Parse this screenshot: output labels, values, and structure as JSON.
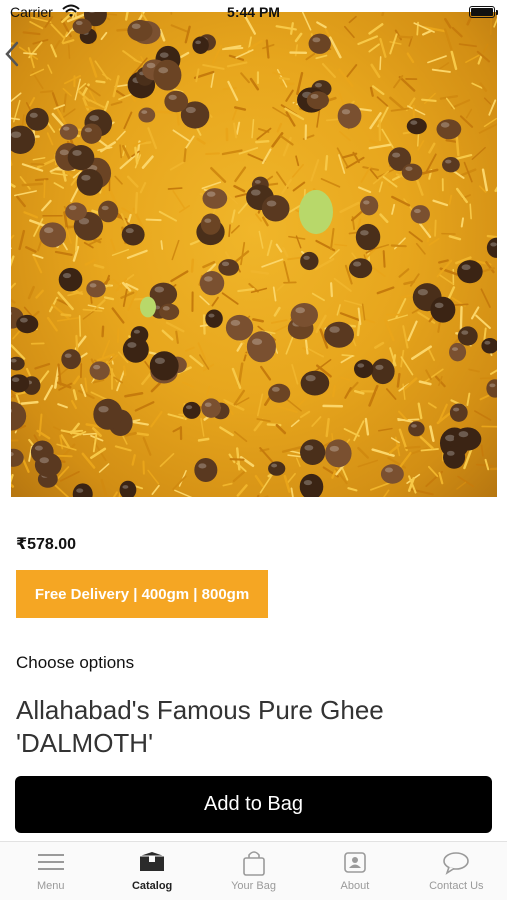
{
  "status_bar": {
    "carrier": "Carrier",
    "time": "5:44 PM"
  },
  "product": {
    "image_description_icon": "food-image",
    "price": "₹578.00",
    "badge": "Free Delivery | 400gm | 800gm",
    "choose_options": "Choose options",
    "title": "Allahabad's Famous Pure Ghee 'DALMOTH'",
    "add_to_bag": "Add to Bag"
  },
  "colors": {
    "badge": "#f5a623",
    "button": "#000000",
    "active_tab": "#222222",
    "inactive_tab": "#9a9a9a"
  },
  "tabs": [
    {
      "label": "Menu",
      "icon": "menu-icon",
      "active": false
    },
    {
      "label": "Catalog",
      "icon": "catalog-icon",
      "active": true
    },
    {
      "label": "Your Bag",
      "icon": "bag-icon",
      "active": false
    },
    {
      "label": "About",
      "icon": "about-icon",
      "active": false
    },
    {
      "label": "Contact Us",
      "icon": "contact-icon",
      "active": false
    }
  ]
}
